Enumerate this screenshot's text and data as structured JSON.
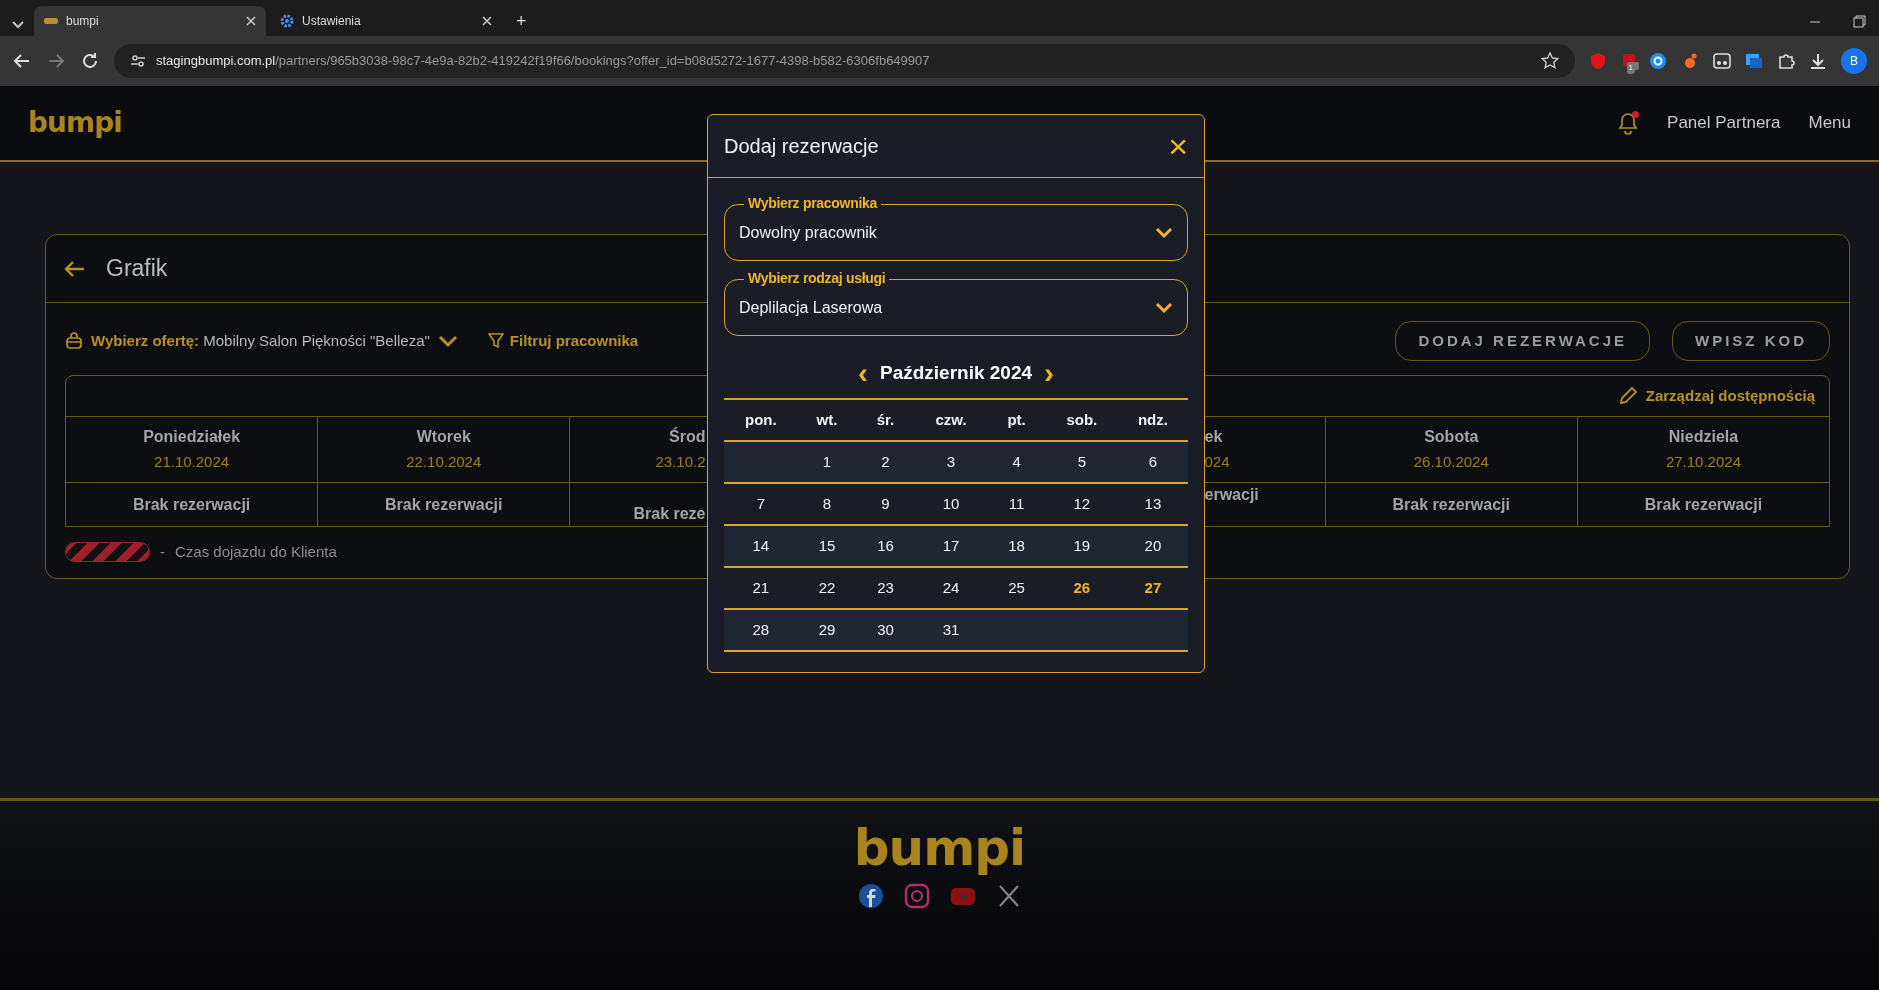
{
  "browser": {
    "tabs": [
      {
        "label": "bumpi",
        "selected": true,
        "kind": "logo"
      },
      {
        "label": "Ustawienia",
        "selected": false,
        "kind": "gear"
      }
    ],
    "new_tab": "+",
    "url_host": "stagingbumpi.com.pl",
    "url_path": "/partners/965b3038-98c7-4e9a-82b2-419242f19f66/bookings?offer_id=b08d5272-1677-4398-b582-6306fb649907",
    "profile": "B",
    "extension_badge": "1"
  },
  "header": {
    "logo": "bumpi",
    "notification": true,
    "links": [
      "Panel Partnera",
      "Menu"
    ]
  },
  "card": {
    "title": "Grafik",
    "offer_label": "Wybierz ofertę:",
    "offer_value": "Mobilny Salon Piękności \"Belleza\"",
    "filter_label": "Filtruj pracownika",
    "buttons": [
      "DODAJ REZERWACJE",
      "WPISZ KOD"
    ],
    "manage_link": "Zarządzaj dostępnością",
    "days": [
      {
        "name": "Poniedziałek",
        "date": "21.10.2024",
        "status": "Brak rezerwacji",
        "kind": "full"
      },
      {
        "name": "Wtorek",
        "date": "22.10.2024",
        "status": "Brak rezerwacji",
        "kind": "full"
      },
      {
        "name": "Środ",
        "date": "23.10.2",
        "status": "Brak reze",
        "kind": "cut-right"
      },
      {
        "name": "ek",
        "date": "024",
        "status": "erwacji",
        "kind": "cut-left"
      },
      {
        "name": "Sobota",
        "date": "26.10.2024",
        "status": "Brak rezerwacji",
        "kind": "full"
      },
      {
        "name": "Niedziela",
        "date": "27.10.2024",
        "status": "Brak rezerwacji",
        "kind": "full"
      }
    ],
    "legend": {
      "dash": "-",
      "text": "Czas dojazdu do Klienta"
    }
  },
  "modal": {
    "title": "Dodaj rezerwacje",
    "close": "×",
    "selects": [
      {
        "label": "Wybierz pracownika",
        "value": "Dowolny pracownik"
      },
      {
        "label": "Wybierz rodzaj usługi",
        "value": "Deplilacja Laserowa"
      }
    ],
    "calendar": {
      "month": "Październik 2024",
      "prev": "‹",
      "next": "›",
      "weekdays": [
        "pon.",
        "wt.",
        "śr.",
        "czw.",
        "pt.",
        "sob.",
        "ndz."
      ],
      "weeks": [
        {
          "kind": "leading-gap",
          "days": [
            {
              "day": "1",
              "highlighted": false
            },
            {
              "day": "2",
              "highlighted": false
            },
            {
              "day": "3",
              "highlighted": false
            },
            {
              "day": "4",
              "highlighted": false
            },
            {
              "day": "5",
              "highlighted": false
            },
            {
              "day": "6",
              "highlighted": false
            }
          ]
        },
        {
          "kind": "full",
          "days": [
            {
              "day": "7",
              "highlighted": false
            },
            {
              "day": "8",
              "highlighted": false
            },
            {
              "day": "9",
              "highlighted": false
            },
            {
              "day": "10",
              "highlighted": false
            },
            {
              "day": "11",
              "highlighted": false
            },
            {
              "day": "12",
              "highlighted": false
            },
            {
              "day": "13",
              "highlighted": false
            }
          ]
        },
        {
          "kind": "full",
          "days": [
            {
              "day": "14",
              "highlighted": false
            },
            {
              "day": "15",
              "highlighted": false
            },
            {
              "day": "16",
              "highlighted": false
            },
            {
              "day": "17",
              "highlighted": false
            },
            {
              "day": "18",
              "highlighted": false
            },
            {
              "day": "19",
              "highlighted": false
            },
            {
              "day": "20",
              "highlighted": false
            }
          ]
        },
        {
          "kind": "full",
          "days": [
            {
              "day": "21",
              "highlighted": false
            },
            {
              "day": "22",
              "highlighted": false
            },
            {
              "day": "23",
              "highlighted": false
            },
            {
              "day": "24",
              "highlighted": false
            },
            {
              "day": "25",
              "highlighted": false
            },
            {
              "day": "26",
              "highlighted": true
            },
            {
              "day": "27",
              "highlighted": true
            }
          ]
        },
        {
          "kind": "trailing-gap",
          "days": [
            {
              "day": "28",
              "highlighted": false
            },
            {
              "day": "29",
              "highlighted": false
            },
            {
              "day": "30",
              "highlighted": false
            },
            {
              "day": "31",
              "highlighted": false
            }
          ]
        }
      ]
    }
  },
  "footer": {
    "logo": "bumpi"
  }
}
